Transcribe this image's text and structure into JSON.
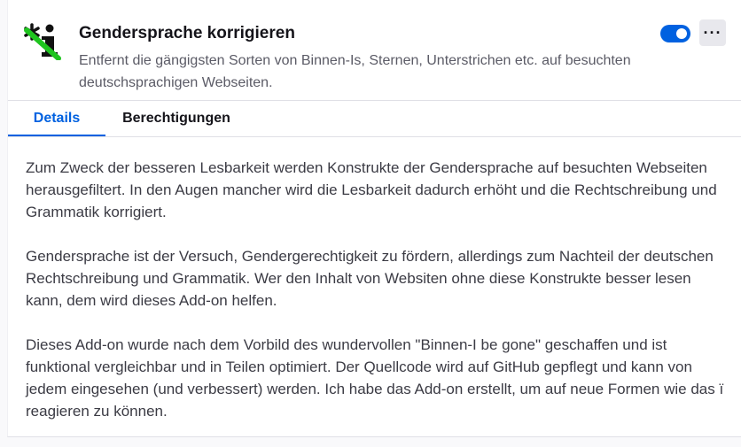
{
  "addon": {
    "name": "Gendersprache korrigieren",
    "summary": "Entfernt die gängigsten Sorten von Binnen-Is, Sternen, Unterstrichen etc. auf besuchten deutschsprachigen Webseiten.",
    "enabled": true,
    "more_label": "···"
  },
  "tabs": [
    {
      "label": "Details",
      "active": true
    },
    {
      "label": "Berechtigungen",
      "active": false
    }
  ],
  "description": [
    "Zum Zweck der besseren Lesbarkeit werden Konstrukte der Gendersprache auf besuchten Webseiten herausgefiltert. In den Augen mancher wird die Lesbarkeit dadurch erhöht und die Rechtschreibung und Grammatik korrigiert.",
    "Gendersprache ist der Versuch, Gendergerechtigkeit zu fördern, allerdings zum Nachteil der deutschen Rechtschreibung und Grammatik. Wer den Inhalt von Websiten ohne diese Konstrukte besser lesen kann, dem wird dieses Add-on helfen.",
    "Dieses Add-on wurde nach dem Vorbild des wundervollen \"Binnen-I be gone\" geschaffen und ist funktional vergleichbar und in Teilen optimiert. Der Quellcode wird auf GitHub gepflegt und kann von jedem eingesehen (und verbessert) werden. Ich habe das Add-on erstellt, um auf neue Formen wie das ï reagieren zu können."
  ],
  "colors": {
    "accent": "#0061e0",
    "icon_green": "#1fc41f",
    "text": "#15141a",
    "muted": "#5b5b66"
  }
}
